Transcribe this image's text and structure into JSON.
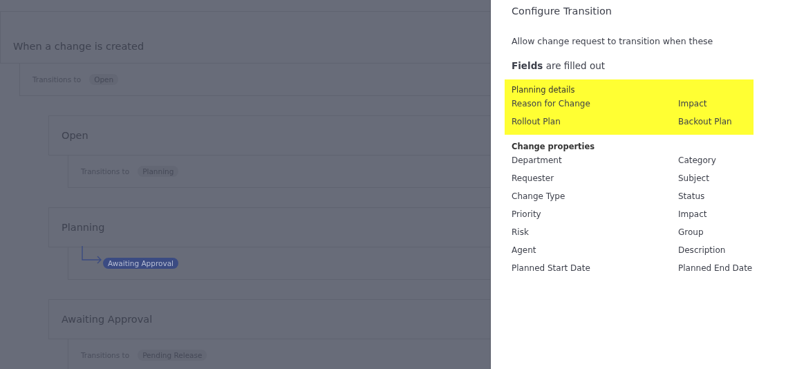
{
  "workflow": {
    "states": [
      {
        "title": "When a change is created",
        "transition": {
          "kind": "label",
          "label": "Transitions to",
          "target": "Open"
        }
      },
      {
        "title": "Open",
        "transition": {
          "kind": "label",
          "label": "Transitions to",
          "target": "Planning"
        }
      },
      {
        "title": "Planning",
        "transition": {
          "kind": "arrow",
          "target": "Awaiting Approval"
        }
      },
      {
        "title": "Awaiting Approval",
        "transition": {
          "kind": "label",
          "label": "Transitions to",
          "target": "Pending Release"
        }
      }
    ]
  },
  "panel": {
    "title": "Configure Transition",
    "description": "Allow change request to transition when these",
    "condition": "**Fields** are filled out",
    "sections": [
      {
        "title": "Planning details",
        "highlighted": true,
        "fields": [
          "Reason for Change",
          "Impact",
          "Rollout Plan",
          "Backout Plan"
        ]
      },
      {
        "title": "Change properties",
        "highlighted": false,
        "fields": [
          "Department",
          "Category",
          "Requester",
          "Subject",
          "Change Type",
          "Status",
          "Priority",
          "Impact",
          "Risk",
          "Group",
          "Agent",
          "Description",
          "Planned Start Date",
          "Planned End Date"
        ]
      }
    ]
  }
}
